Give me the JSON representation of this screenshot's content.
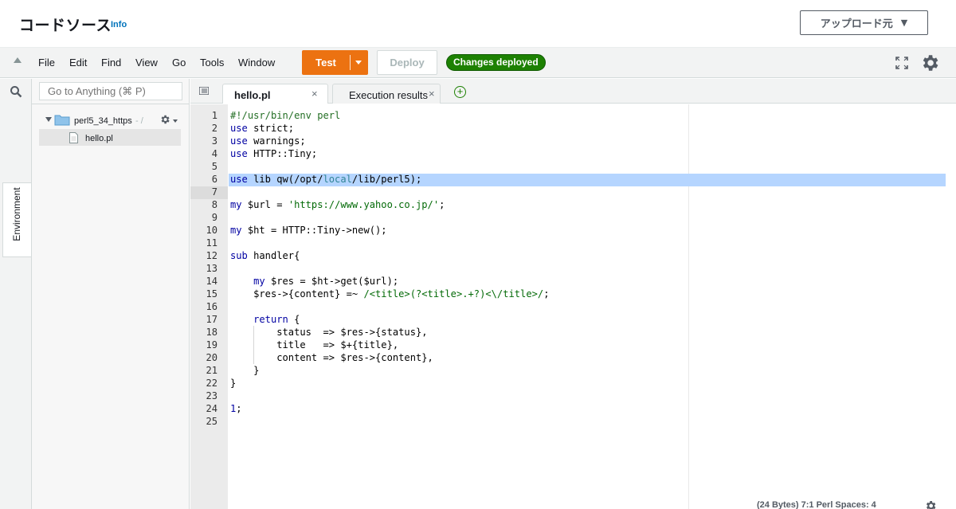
{
  "header": {
    "title": "コードソース",
    "info": "Info",
    "upload_label": "アップロード元",
    "upload_caret": "▼"
  },
  "menubar": {
    "items": [
      "File",
      "Edit",
      "Find",
      "View",
      "Go",
      "Tools",
      "Window"
    ],
    "test_label": "Test",
    "deploy_label": "Deploy",
    "status_badge": "Changes deployed"
  },
  "sidebar": {
    "rail_tab": "Environment",
    "goto_placeholder": "Go to Anything (⌘ P)",
    "folder": {
      "name": "perl5_34_https",
      "path": "- /"
    },
    "file": "hello.pl"
  },
  "tabs": [
    {
      "label": "hello.pl",
      "active": true
    },
    {
      "label": "Execution results",
      "active": false
    }
  ],
  "colors": {
    "accent_orange": "#ec7211",
    "deployed_green": "#1d8102",
    "selection": "#b5d5ff"
  },
  "editor": {
    "lines": [
      "#!/usr/bin/env perl",
      "use strict;",
      "use warnings;",
      "use HTTP::Tiny;",
      "",
      "use lib qw(/opt/local/lib/perl5);",
      "",
      "my $url = 'https://www.yahoo.co.jp/';",
      "",
      "my $ht = HTTP::Tiny->new();",
      "",
      "sub handler{",
      "",
      "    my $res = $ht->get($url);",
      "    $res->{content} =~ /<title>(?<title>.+?)<\\/title>/;",
      "",
      "    return {",
      "        status  => $res->{status},",
      "        title   => $+{title},",
      "        content => $res->{content},",
      "    }",
      "}",
      "",
      "1;",
      ""
    ],
    "status": "(24 Bytes)    7:1    Perl    Spaces: 4"
  }
}
